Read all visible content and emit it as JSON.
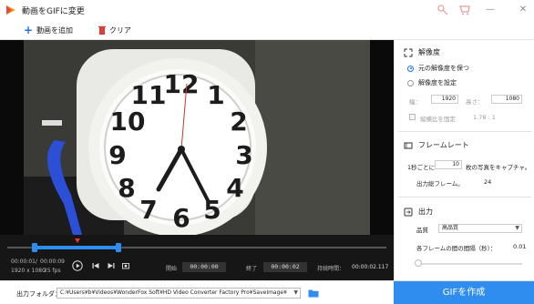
{
  "window": {
    "title": "動画をGIFに変更",
    "controls": {
      "min": "—",
      "max": "☐",
      "close": "✕"
    }
  },
  "toolbar": {
    "add_video_label": "動画を追加",
    "clear_label": "クリア"
  },
  "player": {
    "current_time": "00:00:01",
    "total_time": "00:00:09",
    "time_separator": "/",
    "resolution": "1920 x 1080",
    "fps": "25 fps",
    "start_label": "開始",
    "start_time": "00:00:00",
    "end_label": "終了",
    "end_time": "00:00:02",
    "duration_label": "持続時間：",
    "duration_value": "00:00:02.117",
    "icons": [
      "play-icon",
      "prev-frame-icon",
      "next-frame-icon",
      "snapshot-icon"
    ]
  },
  "resolution_section": {
    "title": "解像度",
    "keep_original_label": "元の解像度を保つ",
    "set_resolution_label": "解像度を設定",
    "width_label": "幅：",
    "width_value": "1920",
    "height_label": "高さ：",
    "height_value": "1080",
    "fix_ratio_label": "縦横比を固定",
    "ratio_value": "1.78 : 1",
    "selected": "keep_original"
  },
  "frame_section": {
    "title": "フレームレート",
    "per_second_label": "1秒ごとに",
    "per_second_value": "10",
    "capture_label": "枚の写真をキャプチャ。",
    "total_frames_label": "出力総フレーム。",
    "total_frames_value": "24"
  },
  "output_section": {
    "title": "出力",
    "quality_label": "品質",
    "quality_value": "高品質",
    "interval_label": "各フレームの間の間隔（秒）：",
    "interval_value": "0.01",
    "interval_fraction": 0.02
  },
  "bottom": {
    "output_folder_label": "出力フォルダ：",
    "output_path": "C:¥Users¥b¥Videos¥WonderFox Soft¥HD Video Converter Factory Pro¥SaveImage¥",
    "create_gif_label": "GIFを作成"
  },
  "colors": {
    "accent": "#2f8df0",
    "slider_fill": "#e05a5a",
    "player_bg": "#161616"
  }
}
